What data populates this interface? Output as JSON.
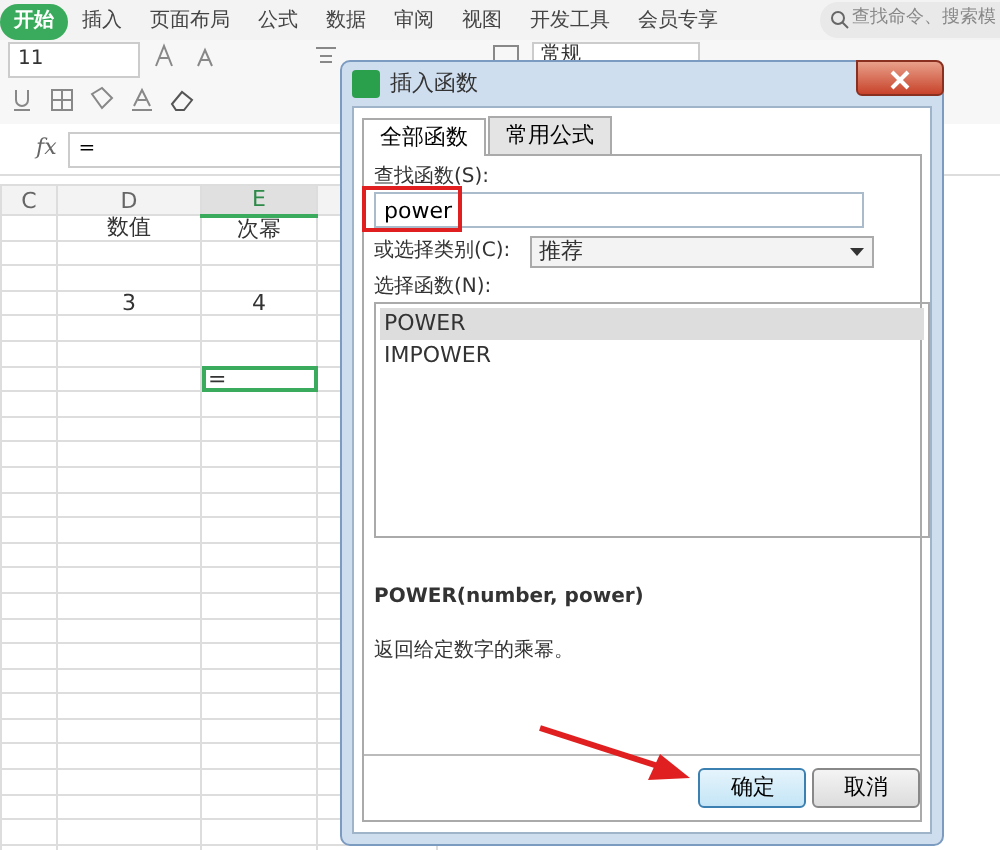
{
  "ribbon": {
    "tabs": [
      {
        "label": "开始",
        "selected": true
      },
      {
        "label": "插入",
        "selected": false
      },
      {
        "label": "页面布局",
        "selected": false
      },
      {
        "label": "公式",
        "selected": false
      },
      {
        "label": "数据",
        "selected": false
      },
      {
        "label": "审阅",
        "selected": false
      },
      {
        "label": "视图",
        "selected": false
      },
      {
        "label": "开发工具",
        "selected": false
      },
      {
        "label": "会员专享",
        "selected": false
      }
    ],
    "search_placeholder": "查找命令、搜索模",
    "font_size": "11",
    "number_format": "常规"
  },
  "formula_bar": {
    "fx": "fx",
    "value": "="
  },
  "sheet": {
    "columns": [
      {
        "label": "C",
        "selected": false
      },
      {
        "label": "D",
        "selected": false
      },
      {
        "label": "E",
        "selected": true
      }
    ],
    "rows": [
      {
        "cells": [
          {
            "text": "",
            "selected": false
          },
          {
            "text": "数值",
            "selected": false
          },
          {
            "text": "次幂",
            "selected": false
          }
        ]
      },
      {
        "cells": [
          {
            "text": "",
            "selected": false
          },
          {
            "text": "",
            "selected": false
          },
          {
            "text": "",
            "selected": false
          }
        ]
      },
      {
        "cells": [
          {
            "text": "",
            "selected": false
          },
          {
            "text": "",
            "selected": false
          },
          {
            "text": "",
            "selected": false
          }
        ]
      },
      {
        "cells": [
          {
            "text": "",
            "selected": false
          },
          {
            "text": "3",
            "selected": false
          },
          {
            "text": "4",
            "selected": false
          }
        ]
      },
      {
        "cells": [
          {
            "text": "",
            "selected": false
          },
          {
            "text": "",
            "selected": false
          },
          {
            "text": "",
            "selected": false
          }
        ]
      },
      {
        "cells": [
          {
            "text": "",
            "selected": false
          },
          {
            "text": "",
            "selected": false
          },
          {
            "text": "",
            "selected": false
          }
        ]
      },
      {
        "cells": [
          {
            "text": "",
            "selected": false
          },
          {
            "text": "",
            "selected": false
          },
          {
            "text": "=",
            "selected": true
          }
        ]
      }
    ]
  },
  "dialog": {
    "title": "插入函数",
    "tabs": [
      {
        "label": "全部函数",
        "selected": true
      },
      {
        "label": "常用公式",
        "selected": false
      }
    ],
    "search_label": "查找函数(S):",
    "search_value": "power",
    "search_highlighted": true,
    "category_label": "或选择类别(C):",
    "category_value": "推荐",
    "list_label": "选择函数(N):",
    "functions": [
      {
        "name": "POWER",
        "selected": true
      },
      {
        "name": "IMPOWER",
        "selected": false
      }
    ],
    "signature": "POWER(number, power)",
    "description": "返回给定数字的乘幂。",
    "buttons": [
      {
        "label": "确定",
        "kind": "primary"
      },
      {
        "label": "取消",
        "kind": "secondary"
      }
    ]
  }
}
